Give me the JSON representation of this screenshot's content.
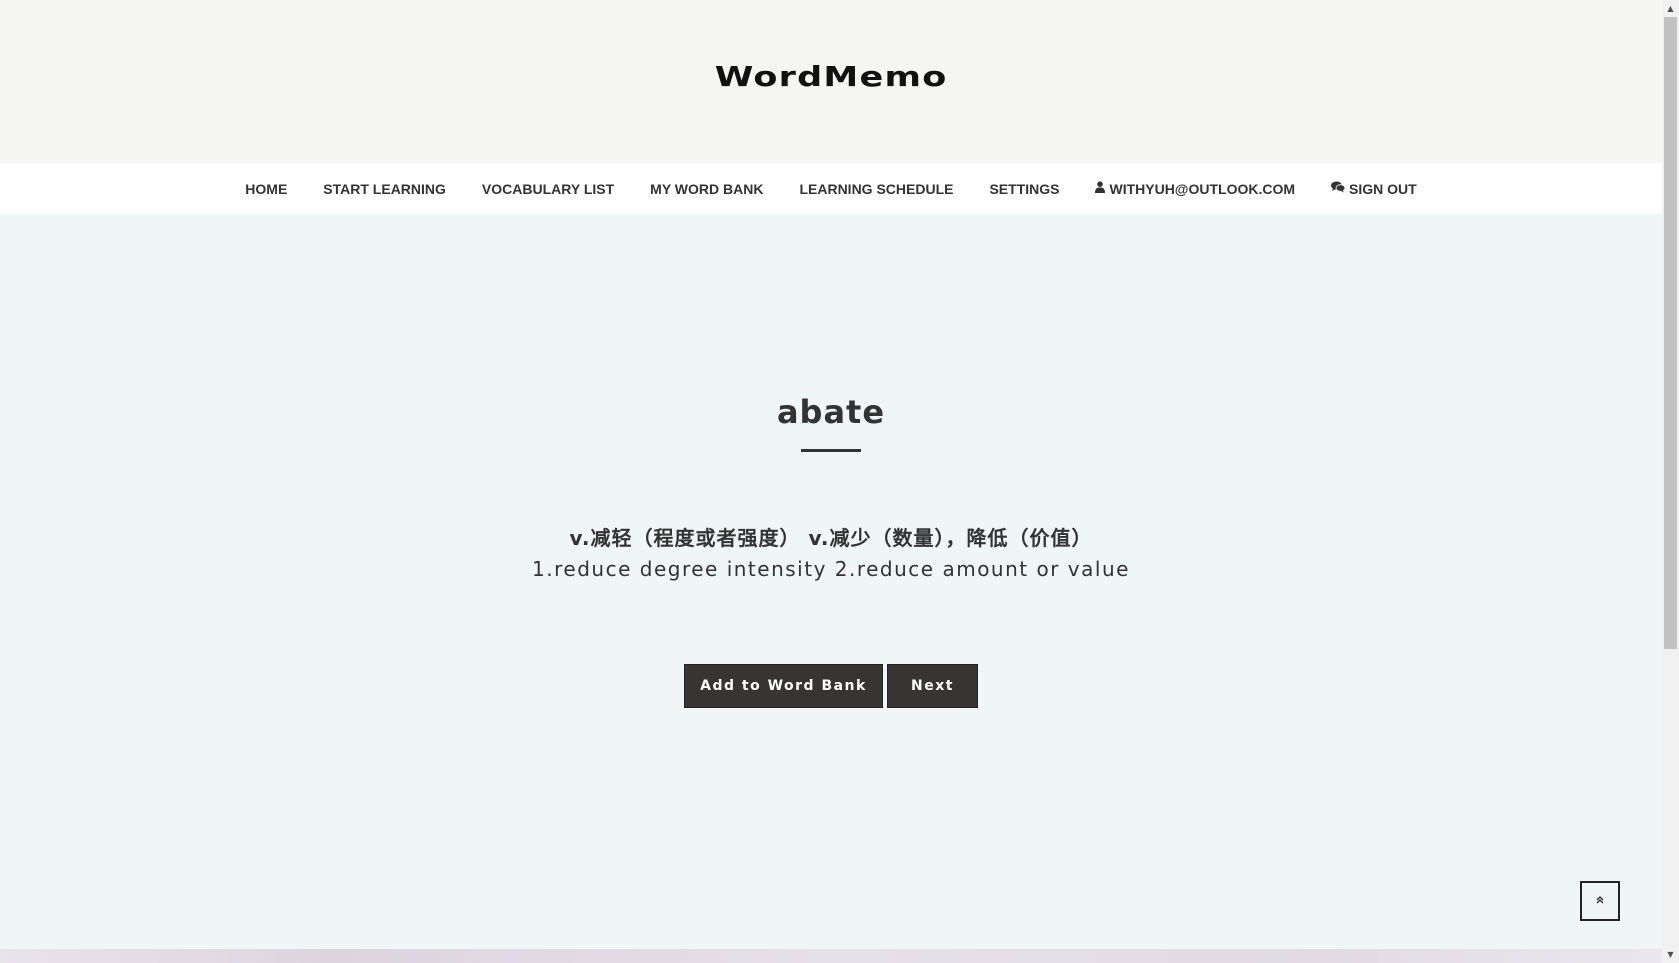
{
  "header": {
    "logo_text": "WordMemo"
  },
  "nav": {
    "items": [
      {
        "label": "HOME"
      },
      {
        "label": "START LEARNING"
      },
      {
        "label": "VOCABULARY LIST"
      },
      {
        "label": "MY WORD BANK"
      },
      {
        "label": "LEARNING SCHEDULE"
      },
      {
        "label": "SETTINGS"
      },
      {
        "label": "WITHYUH@OUTLOOK.COM",
        "icon": "user-icon"
      },
      {
        "label": "SIGN OUT",
        "icon": "comments-icon"
      }
    ]
  },
  "card": {
    "word": "abate",
    "definition_cn": "v.减轻（程度或者强度） v.减少（数量），降低（价值）",
    "definition_en": "1.reduce degree intensity 2.reduce amount or value",
    "add_button_label": "Add to Word Bank",
    "next_button_label": "Next"
  },
  "scroll_top": {
    "icon": "double-chevron-up-icon",
    "glyph": "«"
  },
  "colors": {
    "header_bg": "#f5f5f3",
    "nav_bg": "#ffffff",
    "main_bg": "#f0f5f5",
    "button_bg": "#363532",
    "text": "#333333"
  }
}
